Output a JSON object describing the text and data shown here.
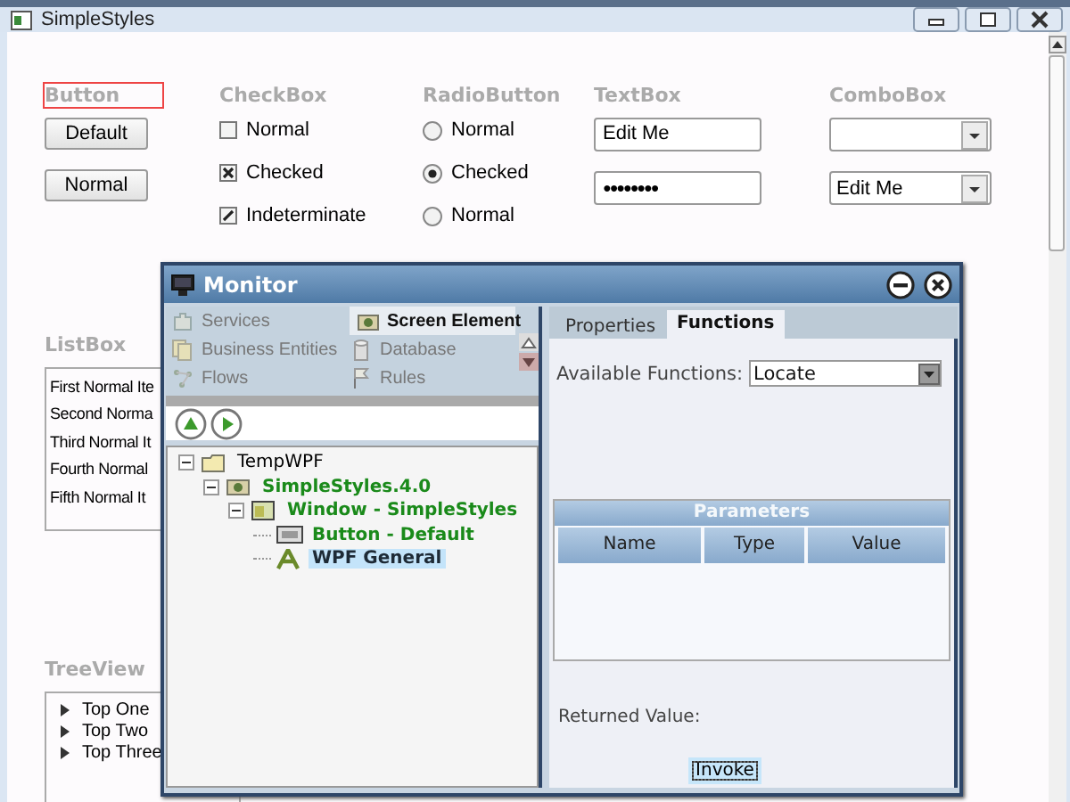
{
  "window": {
    "title": "SimpleStyles"
  },
  "button_section": {
    "label": "Button",
    "focused": true,
    "buttons": [
      "Default",
      "Normal"
    ]
  },
  "checkbox_section": {
    "label": "CheckBox",
    "items": [
      {
        "label": "Normal",
        "checked": false,
        "indeterminate": false
      },
      {
        "label": "Checked",
        "checked": true,
        "indeterminate": false
      },
      {
        "label": "Indeterminate",
        "checked": false,
        "indeterminate": true
      }
    ]
  },
  "radio_section": {
    "label": "RadioButton",
    "items": [
      {
        "label": "Normal",
        "selected": false
      },
      {
        "label": "Checked",
        "selected": true
      },
      {
        "label": "Normal",
        "selected": false
      }
    ]
  },
  "textbox_section": {
    "label": "TextBox",
    "fields": [
      {
        "kind": "text",
        "value": "Edit Me"
      },
      {
        "kind": "password",
        "value": "●●●●●●●●"
      }
    ]
  },
  "combobox_section": {
    "label": "ComboBox",
    "combos": [
      {
        "kind": "empty"
      },
      {
        "kind": "filled",
        "value": "Edit Me"
      }
    ]
  },
  "listbox": {
    "label": "ListBox",
    "items": [
      "First Normal Ite",
      "Second Norma",
      "Third Normal It",
      "Fourth Normal",
      "Fifth Normal It"
    ]
  },
  "treeview": {
    "label": "TreeView",
    "items": [
      "Top One",
      "Top Two",
      "Top Three"
    ]
  },
  "monitor": {
    "title": "Monitor",
    "left_tabs": [
      {
        "label": "Services",
        "kind": "puzzle",
        "selected": false
      },
      {
        "label": "Screen Element",
        "kind": "camera",
        "selected": true
      },
      {
        "label": "Business Entities",
        "kind": "docs",
        "selected": false
      },
      {
        "label": "Database",
        "kind": "database",
        "selected": false
      },
      {
        "label": "Flows",
        "kind": "flow",
        "selected": false
      },
      {
        "label": "Rules",
        "kind": "flag",
        "selected": false
      }
    ],
    "tree": [
      {
        "label": "TempWPF",
        "kind": "folder",
        "color": "#000000",
        "expanded": true,
        "selected": false,
        "children": [
          {
            "label": "SimpleStyles.4.0",
            "kind": "app",
            "color": "#1a8a1a",
            "expanded": true,
            "selected": false,
            "children": [
              {
                "label": "Window - SimpleStyles",
                "kind": "window",
                "color": "#1a8a1a",
                "expanded": true,
                "selected": false,
                "children": [
                  {
                    "label": "Button - Default",
                    "kind": "button",
                    "color": "#1a8a1a",
                    "selected": false
                  },
                  {
                    "label": "WPF General",
                    "kind": "text",
                    "color": "#1e2a36",
                    "selected": true
                  }
                ]
              }
            ]
          }
        ]
      }
    ],
    "right_tabs": [
      {
        "label": "Properties",
        "selected": false
      },
      {
        "label": "Functions",
        "selected": true
      }
    ],
    "functions_label": "Available Functions:",
    "function_value": "Locate",
    "parameters": {
      "title": "Parameters",
      "columns": [
        "Name",
        "Type",
        "Value"
      ]
    },
    "returned_label": "Returned Value:",
    "invoke_button": "Invoke"
  }
}
